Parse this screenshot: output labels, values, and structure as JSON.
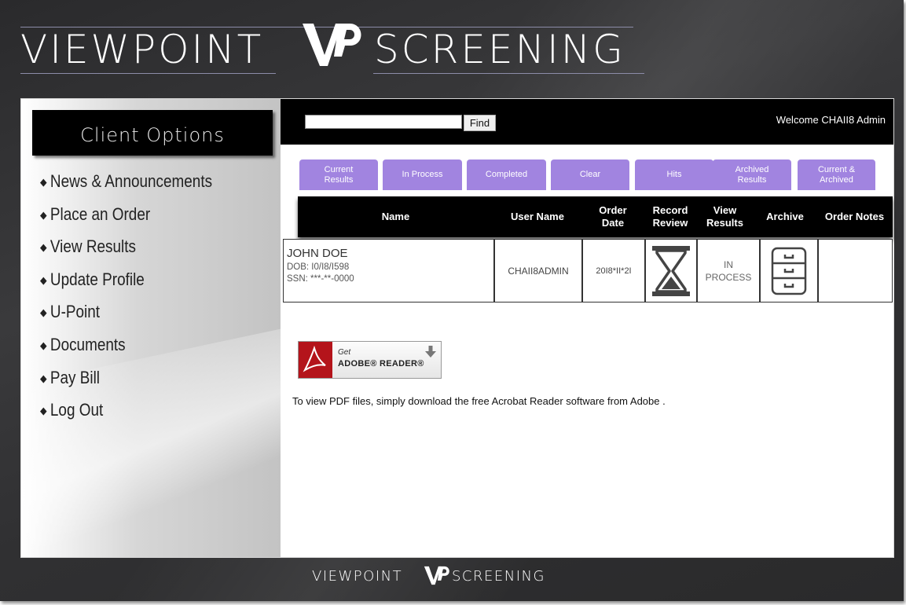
{
  "logo": {
    "word_left": "VIEWPOINT",
    "word_right": "SCREENING"
  },
  "footer_logo": {
    "word_left": "VIEWPOINT",
    "word_right": "SCREENING"
  },
  "sidebar": {
    "title": "Client Options",
    "items": [
      {
        "label": "News & Announcements"
      },
      {
        "label": "Place an Order"
      },
      {
        "label": "View Results"
      },
      {
        "label": "Update Profile"
      },
      {
        "label": "U-Point"
      },
      {
        "label": "Documents"
      },
      {
        "label": "Pay Bill"
      },
      {
        "label": "Log Out"
      }
    ]
  },
  "topbar": {
    "search_value": "",
    "find_label": "Find",
    "welcome": "Welcome CHAII8 Admin"
  },
  "tabs": [
    {
      "line1": "Current",
      "line2": "Results"
    },
    {
      "line1": "In Process",
      "line2": ""
    },
    {
      "line1": "Completed",
      "line2": ""
    },
    {
      "line1": "Clear",
      "line2": ""
    },
    {
      "line1": "Hits",
      "line2": ""
    },
    {
      "line1": "Archived",
      "line2": "Results"
    },
    {
      "line1": "Current &",
      "line2": "Archived"
    }
  ],
  "table": {
    "headers": [
      {
        "line1": "Name",
        "line2": ""
      },
      {
        "line1": "User Name",
        "line2": ""
      },
      {
        "line1": "Order",
        "line2": "Date"
      },
      {
        "line1": "Record",
        "line2": "Review"
      },
      {
        "line1": "View",
        "line2": "Results"
      },
      {
        "line1": "Archive",
        "line2": ""
      },
      {
        "line1": "Order Notes",
        "line2": ""
      }
    ],
    "rows": [
      {
        "name": "JOHN DOE",
        "dob": "DOB: I0/I8/I598",
        "ssn": "SSN: ***-**-0000",
        "user_name": "CHAII8ADMIN",
        "order_date": "20I8*II*2I",
        "record_review_icon": "hourglass-icon",
        "view_results_line1": "IN",
        "view_results_line2": "PROCESS",
        "archive_icon": "file-cabinet-icon",
        "order_notes": ""
      }
    ]
  },
  "adobe": {
    "get": "Get",
    "reader": "ADOBE® READER®",
    "note": "To view PDF files, simply download the free Acrobat Reader software from Adobe ."
  },
  "colors": {
    "tab_purple": "#a184e0",
    "adobe_red": "#b4141b",
    "header_black": "#000000"
  }
}
